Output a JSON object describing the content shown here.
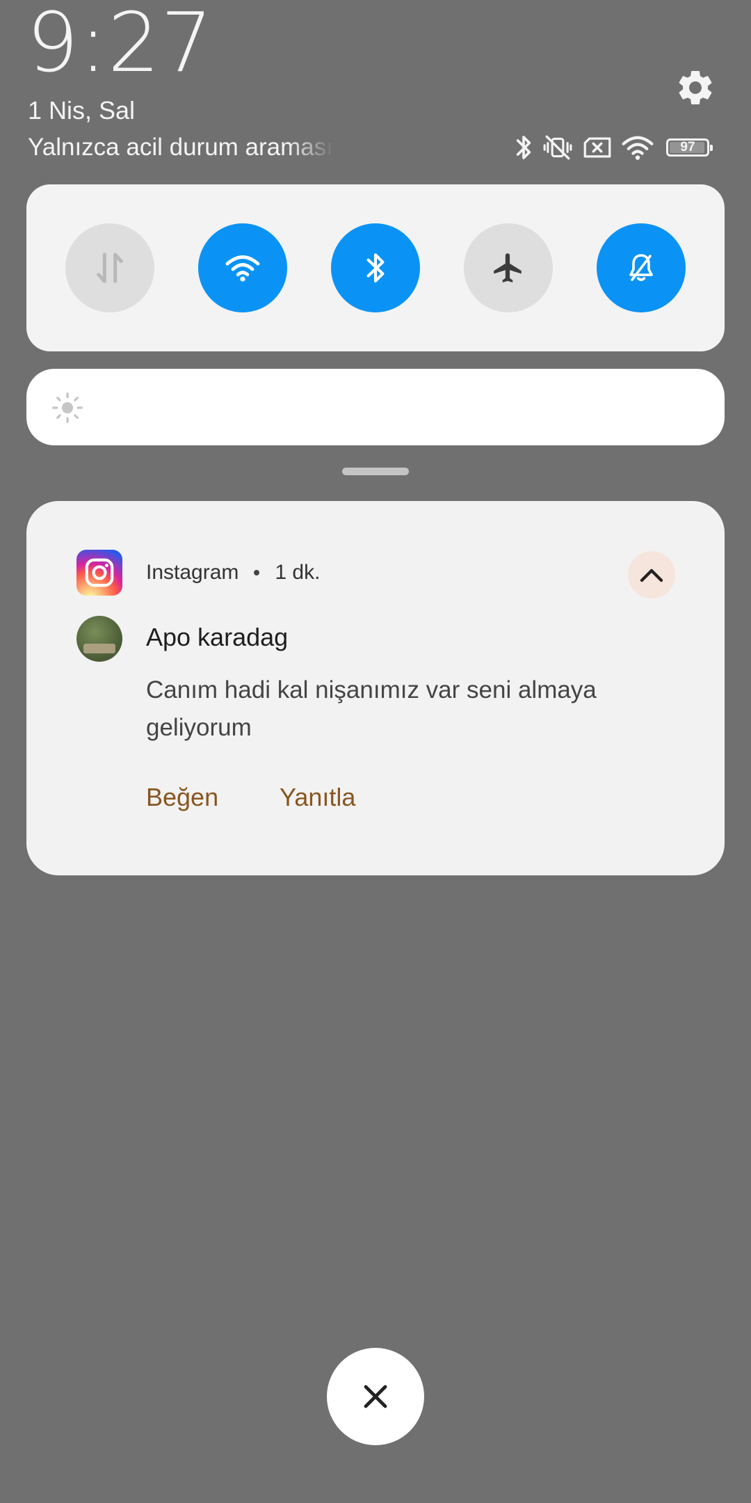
{
  "status": {
    "time": "9:27",
    "date": "1 Nis, Sal",
    "carrier_text": "Yalnızca acil durum araması",
    "battery_level": "97",
    "battery_fraction": 0.97
  },
  "quick_toggles": [
    {
      "id": "mobile-data",
      "icon": "data-arrows-icon",
      "active": false
    },
    {
      "id": "wifi",
      "icon": "wifi-icon",
      "active": true
    },
    {
      "id": "bluetooth",
      "icon": "bluetooth-icon",
      "active": true
    },
    {
      "id": "airplane",
      "icon": "airplane-icon",
      "active": false
    },
    {
      "id": "mute",
      "icon": "bell-off-icon",
      "active": true
    }
  ],
  "notification": {
    "app_name": "Instagram",
    "time_ago": "1 dk.",
    "sender": "Apo karadag",
    "message": "Canım hadi kal nişanımız var seni almaya geliyorum",
    "actions": {
      "like": "Beğen",
      "reply": "Yanıtla"
    }
  },
  "colors": {
    "background": "#707070",
    "toggle_on": "#0a93f5",
    "toggle_off": "#dedede",
    "action_text": "#8a5520"
  }
}
